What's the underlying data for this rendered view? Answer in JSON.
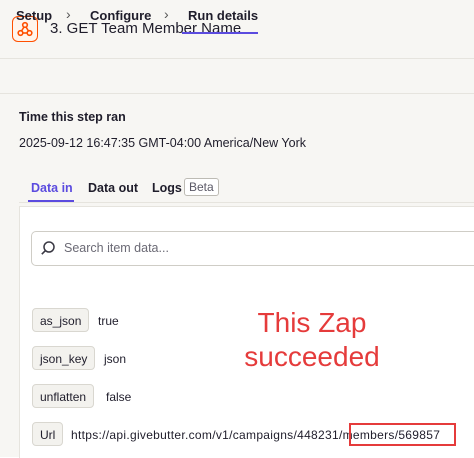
{
  "header": {
    "title": "3. GET Team Member Name"
  },
  "breadcrumb": {
    "items": [
      "Setup",
      "Configure",
      "Run details"
    ],
    "active": "Run details"
  },
  "run": {
    "time_label": "Time this step ran",
    "time_value": "2025-09-12 16:47:35 GMT-04:00 America/New York"
  },
  "subtabs": {
    "data_in": "Data in",
    "data_out": "Data out",
    "logs": "Logs",
    "beta": "Beta",
    "active": "Data in"
  },
  "search": {
    "placeholder": "Search item data..."
  },
  "fields": [
    {
      "key": "as_json",
      "value": "true"
    },
    {
      "key": "json_key",
      "value": "json"
    },
    {
      "key": "unflatten",
      "value": "false"
    },
    {
      "key": "Url",
      "value": "https://api.givebutter.com/v1/campaigns/448231/members/569857"
    }
  ],
  "annotation": {
    "line1": "This Zap",
    "line2": "succeeded"
  },
  "colors": {
    "accent": "#5b4bdf",
    "brand": "#ff4f00",
    "annotation": "#e53b3b"
  }
}
